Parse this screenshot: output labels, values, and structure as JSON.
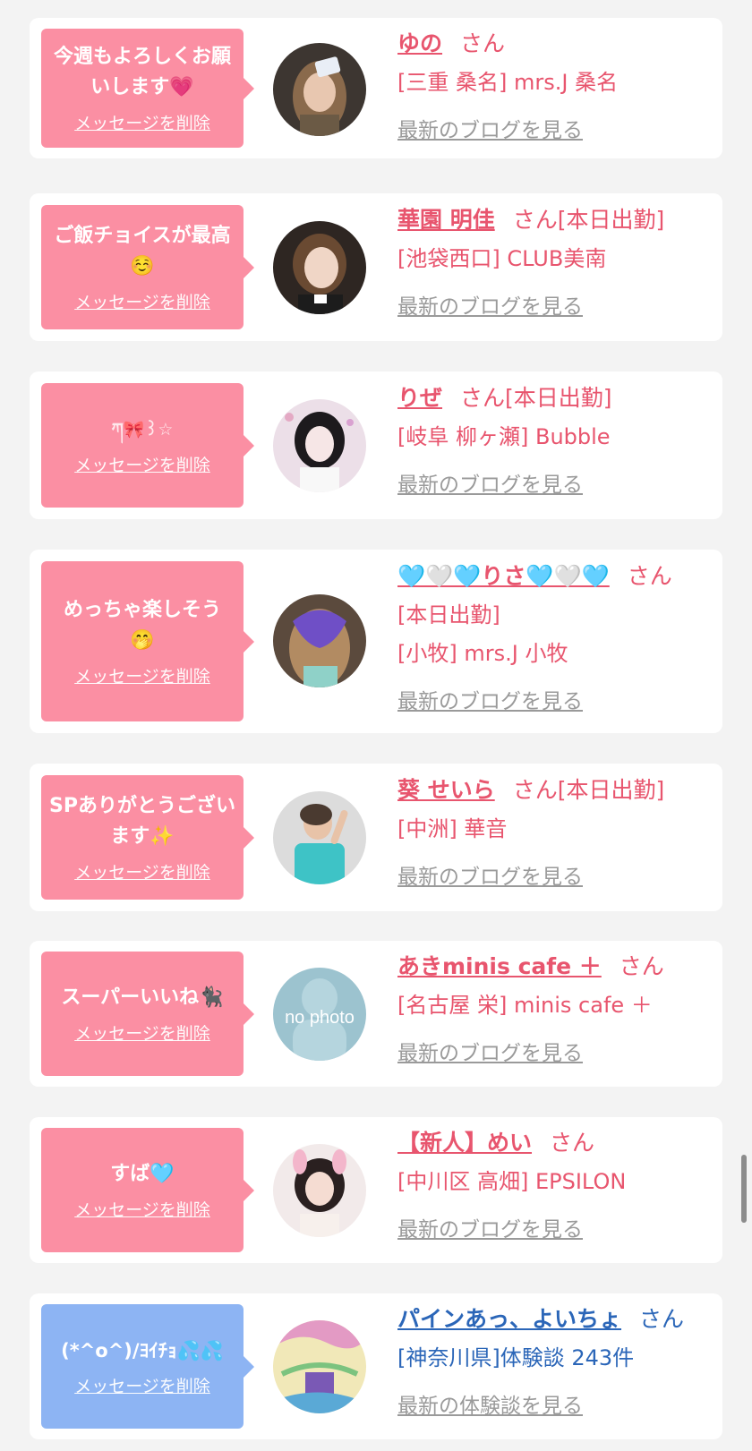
{
  "delete_label": "メッセージを削除",
  "items": [
    {
      "message": "今週もよろしくお願いします💗",
      "name": "ゆの",
      "san": "さん",
      "status": "",
      "location": "[三重 桑名] mrs.J 桑名",
      "link": "最新のブログを見る"
    },
    {
      "message": "ご飯チョイスが最高☺️",
      "name": "華園 明佳",
      "san": "さん",
      "status": "[本日出勤]",
      "location": "[池袋西口] CLUB美南",
      "link": "最新のブログを見る"
    },
    {
      "message": "ཀ🎀꒱☆",
      "name": "りぜ",
      "san": "さん",
      "status": "[本日出勤]",
      "location": "[岐阜 柳ヶ瀬] Bubble",
      "link": "最新のブログを見る"
    },
    {
      "message": "めっちゃ楽しそう🤭",
      "name": "🩵🤍🩵りさ🩵🤍🩵",
      "san": "さん",
      "status": "[本日出勤]",
      "location": "[小牧] mrs.J 小牧",
      "link": "最新のブログを見る"
    },
    {
      "message": "SPありがとうございます✨",
      "name": "葵 せいら",
      "san": "さん",
      "status": "[本日出勤]",
      "location": "[中洲] 華音",
      "link": "最新のブログを見る"
    },
    {
      "message": "スーパーいいね🐈‍⬛",
      "name": "あきminis cafe ＋",
      "san": "さん",
      "status": "",
      "location": "[名古屋 栄] minis cafe ＋",
      "link": "最新のブログを見る"
    },
    {
      "message": "すば🩵",
      "name": "【新人】めい",
      "san": "さん",
      "status": "",
      "location": "[中川区 高畑] EPSILON",
      "link": "最新のブログを見る"
    },
    {
      "message": "(*^o^)/ﾖｲﾁｮ💦💦",
      "name": "パインあっ、よいちょ",
      "san": "さん",
      "status": "",
      "location": "[神奈川県]体験談 243件",
      "link": "最新の体験談を見る"
    }
  ],
  "avatar_placeholder_text": "no photo",
  "colors": {
    "pink_bubble": "#fb8fa3",
    "blue_bubble": "#8db4f3",
    "pink_text": "#e8556e",
    "blue_text": "#2b66b8"
  }
}
